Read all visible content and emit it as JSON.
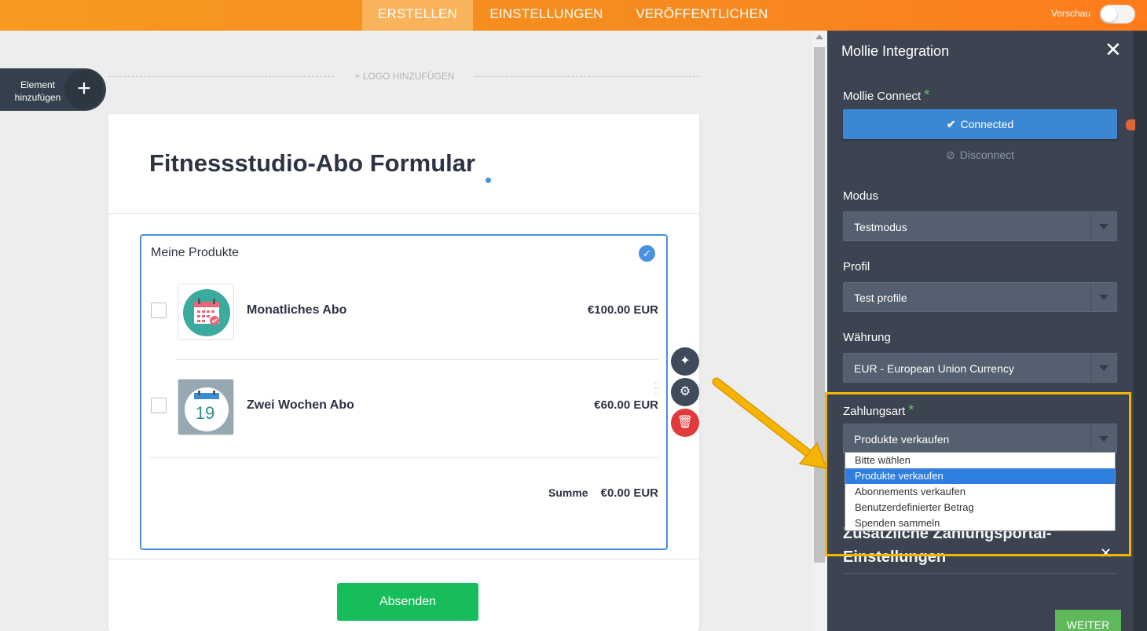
{
  "topbar": {
    "tabs": [
      {
        "label": "ERSTELLEN"
      },
      {
        "label": "EINSTELLUNGEN"
      },
      {
        "label": "VERÖFFENTLICHEN"
      }
    ],
    "preview_label": "Vorschau",
    "preview_enabled": false
  },
  "builder": {
    "add_element_label": "Element hinzufügen",
    "add_element_plus": "+",
    "logo_placeholder": "+ LOGO HINZUFÜGEN"
  },
  "form": {
    "title": "Fitnessstudio-Abo Formular",
    "products_heading": "Meine Produkte",
    "products": [
      {
        "name": "Monatliches Abo",
        "price": "€100.00 EUR",
        "icon": "calendar-icon"
      },
      {
        "name": "Zwei Wochen Abo",
        "price": "€60.00 EUR",
        "icon": "calendar-19-icon",
        "icon_text": "19"
      }
    ],
    "sum_label": "Summe",
    "sum_value": "€0.00 EUR",
    "submit_label": "Absenden"
  },
  "panel": {
    "title": "Mollie Integration",
    "close": "✕",
    "connect_label": "Mollie Connect",
    "required_mark": "*",
    "connected_button": "Connected",
    "disconnect_label": "Disconnect",
    "mode_label": "Modus",
    "mode_value": "Testmodus",
    "profile_label": "Profil",
    "profile_value": "Test profile",
    "currency_label": "Währung",
    "currency_value": "EUR - European Union Currency",
    "payment_type_label": "Zahlungsart",
    "payment_type_value": "Produkte verkaufen",
    "payment_options": [
      "Bitte wählen",
      "Produkte verkaufen",
      "Abonnements verkaufen",
      "Benutzerdefinierter Betrag",
      "Spenden sammeln"
    ],
    "selected_option_index": 1,
    "extra_section_title": "Zusätzliche Zahlungsportal-Einstellungen",
    "next_button": "WEITER"
  },
  "colors": {
    "topbar_orange": "#f58a1f",
    "panel_bg": "#3c4451",
    "connect_blue": "#3b87d4",
    "submit_green": "#18bd5b",
    "highlight_yellow": "#f5b400",
    "required_green": "#5fc45d"
  }
}
